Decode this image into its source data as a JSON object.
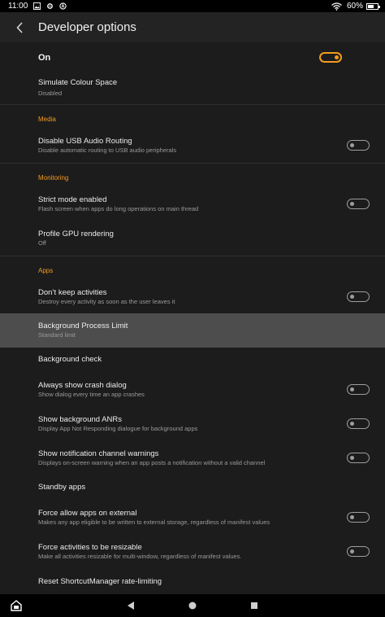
{
  "status_bar": {
    "time": "11:00",
    "battery_text": "60%",
    "battery_level": 0.6,
    "icons": [
      "photo-icon",
      "settings-gear-icon",
      "alexa-icon",
      "wifi-icon",
      "battery-icon"
    ]
  },
  "app_bar": {
    "title": "Developer options",
    "back_icon": "chevron-left-icon"
  },
  "master": {
    "label": "On",
    "enabled": true
  },
  "items": {
    "simulate_colour": {
      "title": "Simulate Colour Space",
      "summary": "Disabled"
    },
    "disable_usb_audio": {
      "title": "Disable USB Audio Routing",
      "summary": "Disable automatic routing to USB audio peripherals",
      "checked": false
    },
    "strict_mode": {
      "title": "Strict mode enabled",
      "summary": "Flash screen when apps do long operations on main thread",
      "checked": false
    },
    "profile_gpu": {
      "title": "Profile GPU rendering",
      "summary": "Off"
    },
    "dont_keep_activities": {
      "title": "Don’t keep activities",
      "summary": "Destroy every activity as soon as the user leaves it",
      "checked": false
    },
    "background_process_limit": {
      "title": "Background Process Limit",
      "summary": "Standard limit"
    },
    "background_check": {
      "title": "Background check"
    },
    "always_show_crash": {
      "title": "Always show crash dialog",
      "summary": "Show dialog every time an app crashes",
      "checked": false
    },
    "show_background_anrs": {
      "title": "Show background ANRs",
      "summary": "Display App Not Responding dialogue for background apps",
      "checked": false
    },
    "notification_channel_warnings": {
      "title": "Show notification channel warnings",
      "summary": "Displays on-screen warning when an app posts a notification without a valid channel",
      "checked": false
    },
    "standby_apps": {
      "title": "Standby apps"
    },
    "force_allow_external": {
      "title": "Force allow apps on external",
      "summary": "Makes any app eligible to be written to external storage, regardless of manifest values",
      "checked": false
    },
    "force_resizable": {
      "title": "Force activities to be resizable",
      "summary": "Make all activities resizable for multi-window, regardless of manifest values.",
      "checked": false
    },
    "reset_shortcut_manager": {
      "title": "Reset ShortcutManager rate-limiting"
    }
  },
  "sections": {
    "media": "Media",
    "monitoring": "Monitoring",
    "apps": "Apps"
  },
  "colors": {
    "accent": "#f39b1e",
    "background": "#1c1c1c",
    "selected_row": "#4d4d4d"
  },
  "nav_bar": {
    "icons": [
      "home-store-icon",
      "back-triangle-icon",
      "home-circle-icon",
      "recents-square-icon"
    ]
  }
}
